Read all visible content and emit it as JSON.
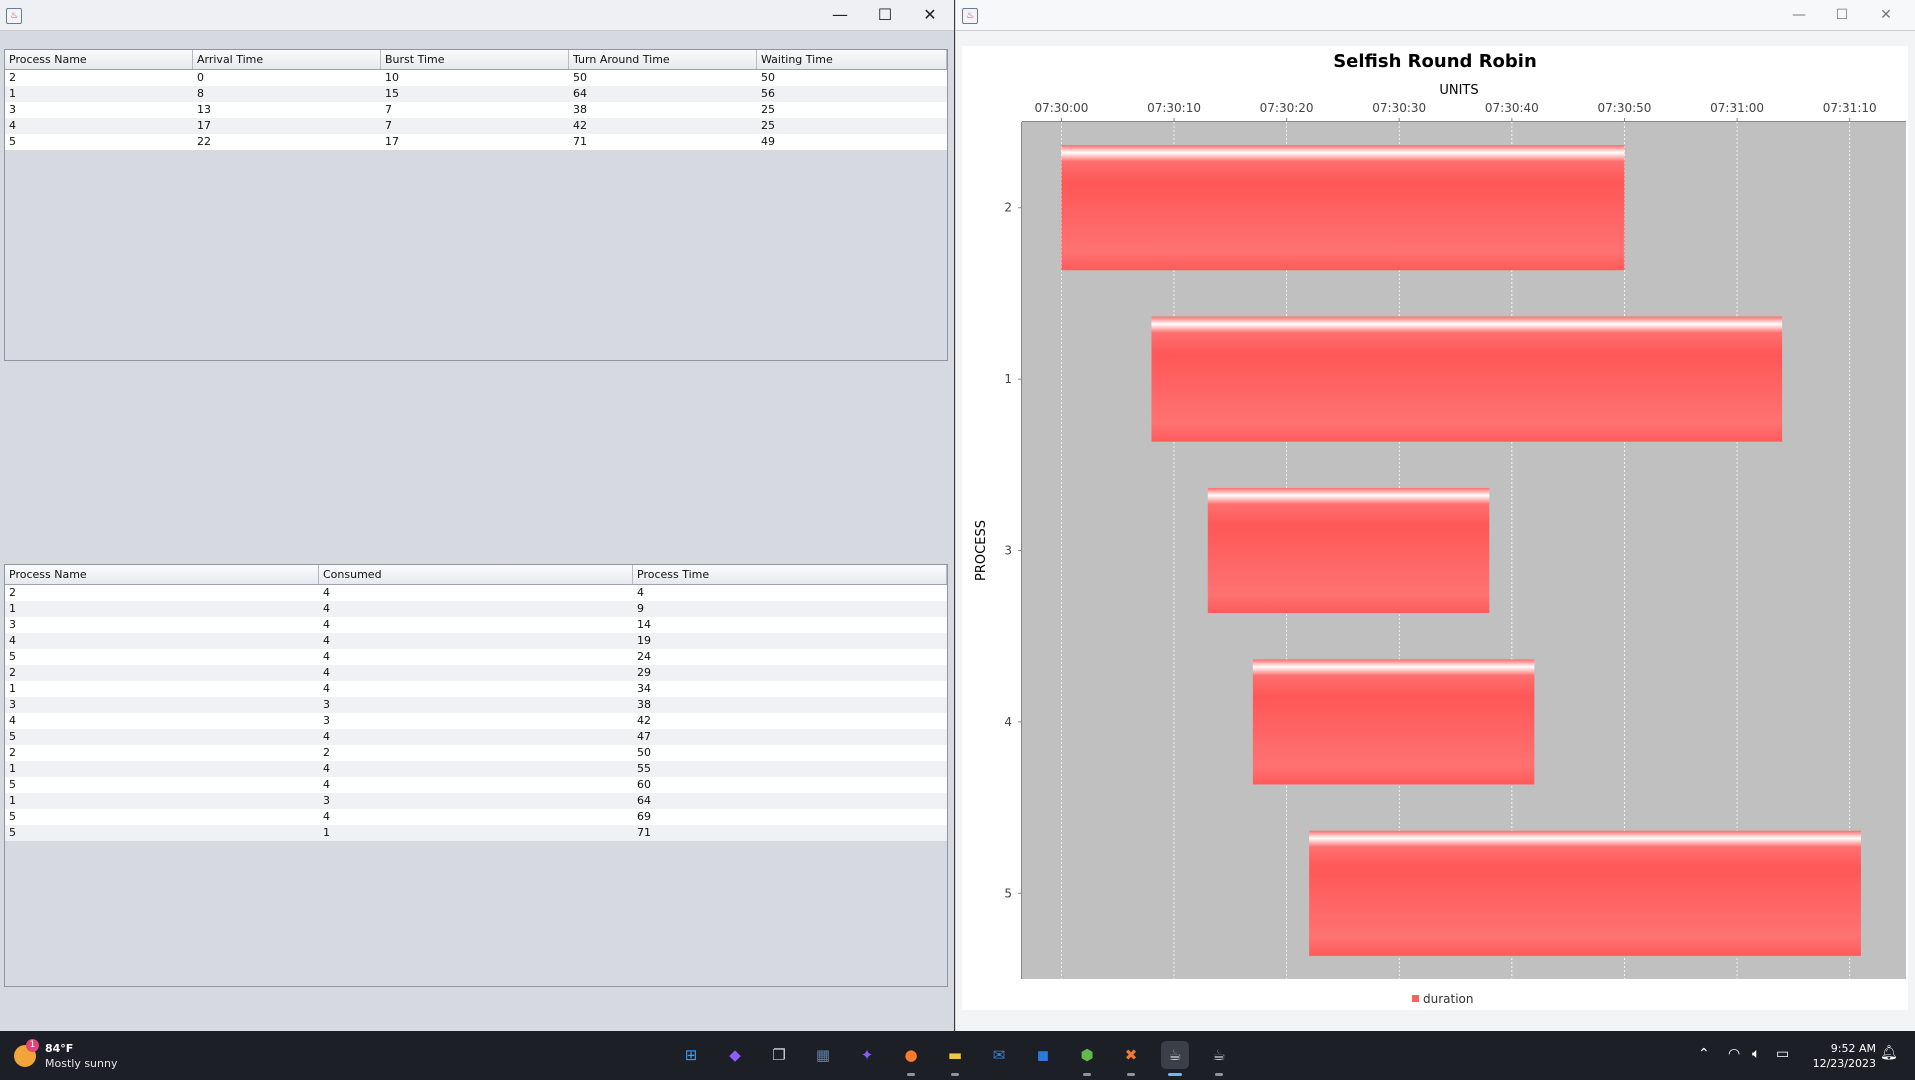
{
  "left_window": {
    "controls": {
      "minimize": "—",
      "maximize": "☐",
      "close": "✕"
    },
    "table1": {
      "headers": [
        "Process Name",
        "Arrival Time",
        "Burst Time",
        "Turn Around Time",
        "Waiting Time"
      ],
      "rows": [
        [
          "2",
          "0",
          "10",
          "50",
          "50"
        ],
        [
          "1",
          "8",
          "15",
          "64",
          "56"
        ],
        [
          "3",
          "13",
          "7",
          "38",
          "25"
        ],
        [
          "4",
          "17",
          "7",
          "42",
          "25"
        ],
        [
          "5",
          "22",
          "17",
          "71",
          "49"
        ]
      ]
    },
    "table2": {
      "headers": [
        "Process Name",
        "Consumed",
        "Process Time"
      ],
      "rows": [
        [
          "2",
          "4",
          "4"
        ],
        [
          "1",
          "4",
          "9"
        ],
        [
          "3",
          "4",
          "14"
        ],
        [
          "4",
          "4",
          "19"
        ],
        [
          "5",
          "4",
          "24"
        ],
        [
          "2",
          "4",
          "29"
        ],
        [
          "1",
          "4",
          "34"
        ],
        [
          "3",
          "3",
          "38"
        ],
        [
          "4",
          "3",
          "42"
        ],
        [
          "5",
          "4",
          "47"
        ],
        [
          "2",
          "2",
          "50"
        ],
        [
          "1",
          "4",
          "55"
        ],
        [
          "5",
          "4",
          "60"
        ],
        [
          "1",
          "3",
          "64"
        ],
        [
          "5",
          "4",
          "69"
        ],
        [
          "5",
          "1",
          "71"
        ]
      ]
    }
  },
  "right_window": {
    "controls": {
      "minimize": "—",
      "maximize": "☐",
      "close": "✕"
    }
  },
  "chart_data": {
    "type": "bar",
    "subtype": "gantt",
    "title": "Selfish Round Robin",
    "xlabel": "UNITS",
    "ylabel": "PROCESS",
    "x_tick_labels": [
      "07:30:00",
      "07:30:10",
      "07:30:20",
      "07:30:30",
      "07:30:40",
      "07:30:50",
      "07:31:00",
      "07:31:10"
    ],
    "xlim_seconds": [
      -3.5,
      75
    ],
    "categories": [
      "2",
      "1",
      "3",
      "4",
      "5"
    ],
    "series": [
      {
        "name": "duration",
        "color": "#ff5f5f",
        "start_seconds": [
          0,
          8,
          13,
          17,
          22
        ],
        "end_seconds": [
          50,
          64,
          38,
          42,
          71
        ]
      }
    ],
    "plot_background": "#c0c0c0",
    "grid": true,
    "legend": "bottom",
    "x_axis_position": "top"
  },
  "taskbar": {
    "weather": {
      "temp": "84°F",
      "condition": "Mostly sunny",
      "badge": "1"
    },
    "clock": {
      "time": "9:52 AM",
      "date": "12/23/2023"
    },
    "apps": [
      {
        "name": "start-icon",
        "glyph": "⊞",
        "color": "#3aa0ff"
      },
      {
        "name": "copilot-icon",
        "glyph": "◆",
        "color": "#8e5cff"
      },
      {
        "name": "task-view-icon",
        "glyph": "❐",
        "color": "#cfd3da"
      },
      {
        "name": "calculator-icon",
        "glyph": "▦",
        "color": "#5b7fa6"
      },
      {
        "name": "messenger-icon",
        "glyph": "✦",
        "color": "#8a5cff"
      },
      {
        "name": "firefox-icon",
        "glyph": "●",
        "color": "#ff7b2e"
      },
      {
        "name": "file-explorer-icon",
        "glyph": "▬",
        "color": "#f4c64a"
      },
      {
        "name": "mail-icon",
        "glyph": "✉",
        "color": "#2a8ae6"
      },
      {
        "name": "store-icon",
        "glyph": "◼",
        "color": "#2f7ad6"
      },
      {
        "name": "app-cube-icon",
        "glyph": "⬢",
        "color": "#65b84a"
      },
      {
        "name": "xampp-icon",
        "glyph": "✖",
        "color": "#f07a2f"
      },
      {
        "name": "java-app-icon-1",
        "glyph": "☕",
        "color": "#d0d4da"
      },
      {
        "name": "java-app-icon-2",
        "glyph": "☕",
        "color": "#d0d4da"
      }
    ]
  }
}
